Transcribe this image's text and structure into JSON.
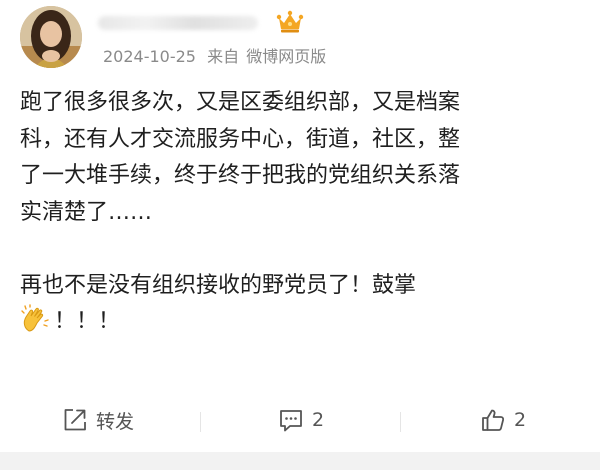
{
  "post": {
    "author": {
      "name": "",
      "avatar_icon": "avatar-photo",
      "badge_icon": "crown-icon"
    },
    "date": "2024-10-25",
    "source_prefix": "来自",
    "source": "微博网页版",
    "content_lines": [
      "跑了很多很多次，又是区委组织部，又是档案",
      "科，还有人才交流服务中心，街道，社区，整",
      "了一大堆手续，终于终于把我的党组织关系落",
      "实清楚了……",
      "再也不是没有组织接收的野党员了！鼓掌",
      "！！！"
    ],
    "emoji": "clap-emoji"
  },
  "actions": {
    "repost_label": "转发",
    "comment_count": "2",
    "like_count": "2",
    "icon_color": "#555555"
  },
  "colors": {
    "text": "#1f1f1f",
    "meta": "#8a8a8a",
    "badge": "#f4a623"
  }
}
